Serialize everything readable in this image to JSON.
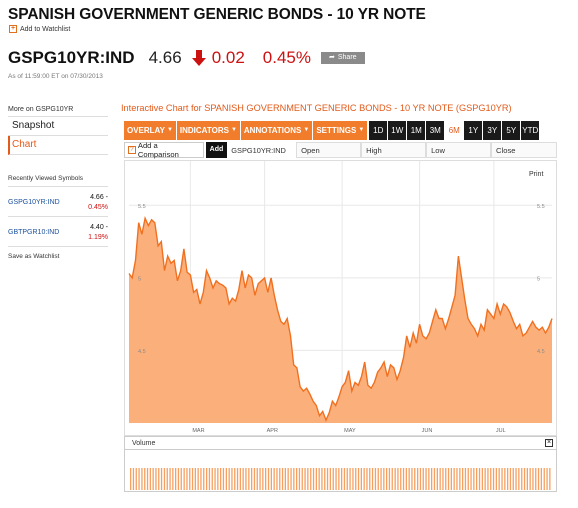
{
  "header": {
    "title": "SPANISH GOVERNMENT GENERIC BONDS - 10 YR NOTE",
    "add_watchlist": "Add to Watchlist",
    "ticker": "GSPG10YR:IND",
    "price": "4.66",
    "change": "0.02",
    "change_pct": "0.45%",
    "share_label": "Share",
    "as_of": "As of 11:59:00 ET on 07/30/2013",
    "change_color": "#cc1111"
  },
  "sidebar": {
    "more_on": "More on GSPG10YR",
    "nav": [
      {
        "label": "Snapshot",
        "active": false
      },
      {
        "label": "Chart",
        "active": true
      }
    ],
    "recent_title": "Recently Viewed Symbols",
    "recent": [
      {
        "symbol": "GSPG10YR:IND",
        "price": "4.66 -",
        "pct": "0.45%"
      },
      {
        "symbol": "GBTPGR10:IND",
        "price": "4.40 -",
        "pct": "1.19%"
      }
    ],
    "save_watchlist": "Save as Watchlist"
  },
  "chart_panel": {
    "heading": "Interactive Chart for SPANISH GOVERNMENT GENERIC BONDS - 10 YR NOTE (GSPG10YR)",
    "menus": [
      "OVERLAY",
      "INDICATORS",
      "ANNOTATIONS",
      "SETTINGS"
    ],
    "ranges": [
      "1D",
      "1W",
      "1M",
      "3M",
      "6M",
      "1Y",
      "3Y",
      "5Y",
      "YTD"
    ],
    "selected_range": "6M",
    "compare_label": "Add a Comparison",
    "add_button": "Add",
    "symbol": "GSPG10YR:IND",
    "fields": [
      "Open",
      "High",
      "Low",
      "Close"
    ],
    "print_label": "Print",
    "volume_label": "Volume",
    "accent_color": "#f07c2c"
  },
  "chart_data": {
    "type": "area",
    "title": "",
    "xlabel": "",
    "ylabel": "",
    "ylim": [
      4.0,
      5.75
    ],
    "y_ticks": [
      "5.5",
      "5",
      "4.5"
    ],
    "x_ticks": [
      "MAR",
      "APR",
      "MAY",
      "JUN",
      "JUL"
    ],
    "grid": true,
    "series": [
      {
        "values": [
          5.03,
          5.0,
          5.12,
          5.38,
          5.3,
          5.41,
          5.36,
          5.4,
          5.38,
          5.22,
          5.25,
          5.05,
          5.15,
          5.1,
          5.12,
          4.98,
          5.05,
          5.2,
          5.04,
          5.02,
          4.9,
          4.92,
          4.82,
          4.9,
          5.05,
          5.0,
          4.93,
          4.98,
          4.96,
          4.95,
          4.93,
          4.82,
          4.86,
          4.84,
          4.92,
          5.05,
          4.93,
          5.02,
          5.0,
          4.88,
          4.96,
          4.98,
          5.0,
          4.9,
          5.0,
          4.88,
          4.78,
          4.7,
          4.68,
          4.72,
          4.6,
          4.4,
          4.38,
          4.25,
          4.22,
          4.24,
          4.2,
          4.15,
          4.12,
          4.05,
          4.08,
          4.02,
          4.07,
          4.15,
          4.12,
          4.18,
          4.25,
          4.28,
          4.36,
          4.22,
          4.28,
          4.26,
          4.32,
          4.42,
          4.26,
          4.24,
          4.28,
          4.35,
          4.38,
          4.42,
          4.32,
          4.4,
          4.38,
          4.3,
          4.36,
          4.45,
          4.6,
          4.52,
          4.62,
          4.55,
          4.68,
          4.6,
          4.58,
          4.62,
          4.7,
          4.78,
          4.72,
          4.72,
          4.65,
          4.72,
          4.8,
          4.88,
          5.15,
          5.0,
          4.85,
          4.72,
          4.68,
          4.65,
          4.6,
          4.68,
          4.64,
          4.78,
          4.75,
          4.72,
          4.82,
          4.75,
          4.82,
          4.8,
          4.76,
          4.7,
          4.65,
          4.68,
          4.6,
          4.62,
          4.66,
          4.7,
          4.66,
          4.64,
          4.66,
          4.62,
          4.66,
          4.72
        ]
      }
    ]
  }
}
